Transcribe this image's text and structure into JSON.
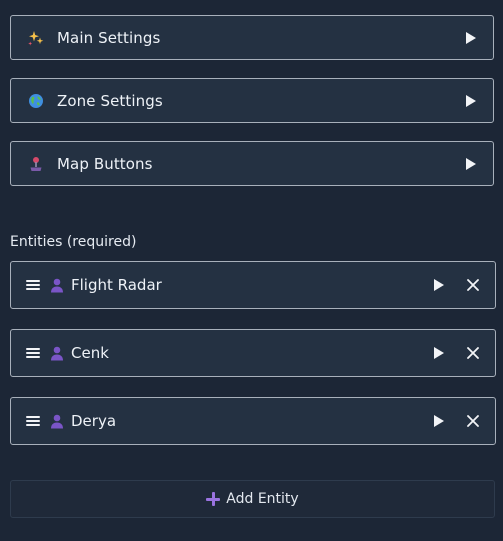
{
  "sections": [
    {
      "label": "Main Settings",
      "icon": "sparkles-icon"
    },
    {
      "label": "Zone Settings",
      "icon": "globe-icon"
    },
    {
      "label": "Map Buttons",
      "icon": "joystick-icon"
    }
  ],
  "entities_heading": "Entities (required)",
  "entities": [
    {
      "name": "Flight Radar",
      "icon": "person-icon"
    },
    {
      "name": "Cenk",
      "icon": "person-icon"
    },
    {
      "name": "Derya",
      "icon": "person-icon"
    }
  ],
  "add_entity": {
    "label": "Add Entity",
    "icon": "plus-icon"
  },
  "colors": {
    "background": "#1c2636",
    "panel": "#243142",
    "border": "#a8b0bb",
    "accent_purple": "#9a73e0"
  }
}
